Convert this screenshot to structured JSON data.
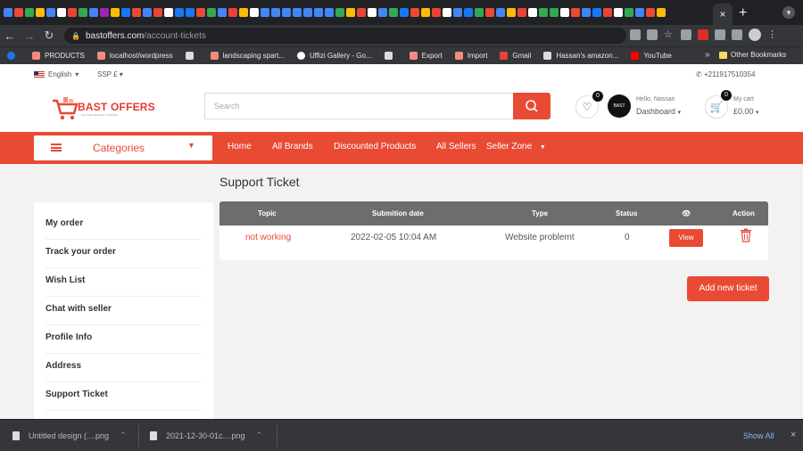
{
  "browser": {
    "tab_close": "×",
    "new_tab": "+",
    "url_host": "bastoffers.com",
    "url_path": "/account-tickets",
    "bookmarks": [
      "PRODUCTS",
      "localhost/wordpress",
      "landscaping spart...",
      "Uffizi Gallery - Go...",
      "Export",
      "Import",
      "Gmail",
      "Hassan's amazon...",
      "YouTube"
    ],
    "bookmarks_more": "»",
    "other_bookmarks": "Other Bookmarks"
  },
  "topbar": {
    "language": "English",
    "currency": "SSP £",
    "phone": "+211917510354"
  },
  "header": {
    "logo_text": "BAST OFFERS",
    "logo_tagline": "FACTOR GENERAL TRADING",
    "search_placeholder": "Search",
    "wishlist_count": "0",
    "avatar_text": "BAST",
    "greeting": "Hello, Nassan",
    "dashboard": "Dashboard",
    "cart_count": "0",
    "cart_label": "My cart",
    "cart_amount": "£0.00"
  },
  "nav": {
    "categories": "Categories",
    "links": [
      "Home",
      "All Brands",
      "Discounted Products",
      "All Sellers",
      "Seller Zone"
    ]
  },
  "sidebar": {
    "items": [
      "My order",
      "Track your order",
      "Wish List",
      "Chat with seller",
      "Profile Info",
      "Address",
      "Support Ticket"
    ]
  },
  "main": {
    "title": "Support Ticket",
    "columns": [
      "Topic",
      "Submition date",
      "Type",
      "Status",
      "Action"
    ],
    "rows": [
      {
        "topic": "not working",
        "date": "2022-02-05 10:04 AM",
        "type": "Website problemt",
        "status": "0",
        "view": "View"
      }
    ],
    "add_button": "Add new ticket"
  },
  "downloads": {
    "items": [
      "Untitled design (....png",
      "2021-12-30-01c....png"
    ],
    "show_all": "Show All",
    "close": "×"
  },
  "colors": {
    "accent": "#e84a34",
    "table_header": "#6d6d6d"
  }
}
